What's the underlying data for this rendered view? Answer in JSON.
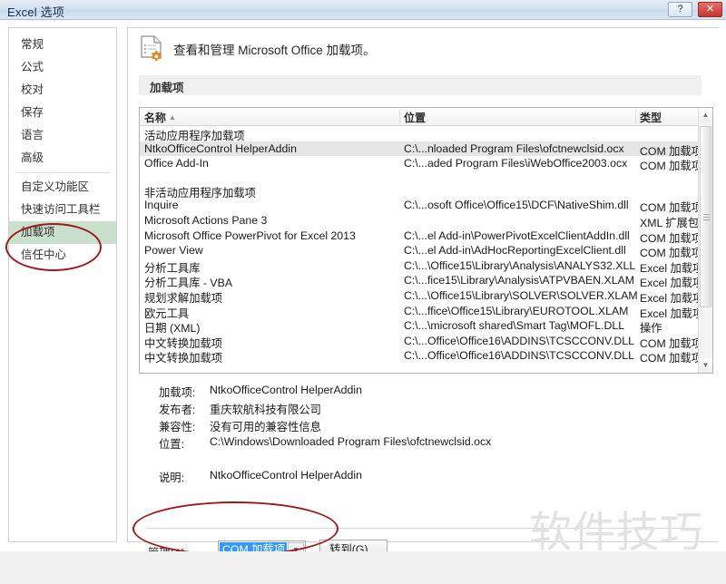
{
  "window": {
    "title": "Excel 选项",
    "help_button": "?",
    "close_button": "✕"
  },
  "sidebar": {
    "items": [
      {
        "label": "常规",
        "selected": false
      },
      {
        "label": "公式",
        "selected": false
      },
      {
        "label": "校对",
        "selected": false
      },
      {
        "label": "保存",
        "selected": false
      },
      {
        "label": "语言",
        "selected": false
      },
      {
        "label": "高级",
        "selected": false
      },
      {
        "label": "自定义功能区",
        "selected": false
      },
      {
        "label": "快速访问工具栏",
        "selected": false
      },
      {
        "label": "加载项",
        "selected": true
      },
      {
        "label": "信任中心",
        "selected": false
      }
    ],
    "separator_after_index": 5
  },
  "pane": {
    "header_title": "查看和管理 Microsoft Office 加载项。",
    "header_icon": "document-gear-icon",
    "section_label": "加载项"
  },
  "list": {
    "columns": [
      {
        "label": "名称",
        "sort_indicator": "▲"
      },
      {
        "label": "位置",
        "sort_indicator": ""
      },
      {
        "label": "类型",
        "sort_indicator": ""
      }
    ],
    "rows": [
      {
        "kind": "group",
        "name": "活动应用程序加载项",
        "location": "",
        "type": "",
        "selected": false
      },
      {
        "kind": "item",
        "name": "NtkoOfficeControl HelperAddin",
        "location": "C:\\...nloaded Program Files\\ofctnewclsid.ocx",
        "type": "COM 加载项",
        "selected": true
      },
      {
        "kind": "item",
        "name": "Office Add-In",
        "location": "C:\\...aded Program Files\\iWebOffice2003.ocx",
        "type": "COM 加载项",
        "selected": false
      },
      {
        "kind": "spacer",
        "name": "",
        "location": "",
        "type": "",
        "selected": false
      },
      {
        "kind": "group",
        "name": "非活动应用程序加载项",
        "location": "",
        "type": "",
        "selected": false
      },
      {
        "kind": "item",
        "name": "Inquire",
        "location": "C:\\...osoft Office\\Office15\\DCF\\NativeShim.dll",
        "type": "COM 加载项",
        "selected": false
      },
      {
        "kind": "item",
        "name": "Microsoft Actions Pane 3",
        "location": "",
        "type": "XML 扩展包",
        "selected": false
      },
      {
        "kind": "item",
        "name": "Microsoft Office PowerPivot for Excel 2013",
        "location": "C:\\...el Add-in\\PowerPivotExcelClientAddIn.dll",
        "type": "COM 加载项",
        "selected": false
      },
      {
        "kind": "item",
        "name": "Power View",
        "location": "C:\\...el Add-in\\AdHocReportingExcelClient.dll",
        "type": "COM 加载项",
        "selected": false
      },
      {
        "kind": "item",
        "name": "分析工具库",
        "location": "C:\\...\\Office15\\Library\\Analysis\\ANALYS32.XLL",
        "type": "Excel 加载项",
        "selected": false
      },
      {
        "kind": "item",
        "name": "分析工具库 - VBA",
        "location": "C:\\...fice15\\Library\\Analysis\\ATPVBAEN.XLAM",
        "type": "Excel 加载项",
        "selected": false
      },
      {
        "kind": "item",
        "name": "规划求解加载项",
        "location": "C:\\...\\Office15\\Library\\SOLVER\\SOLVER.XLAM",
        "type": "Excel 加载项",
        "selected": false
      },
      {
        "kind": "item",
        "name": "欧元工具",
        "location": "C:\\...ffice\\Office15\\Library\\EUROTOOL.XLAM",
        "type": "Excel 加载项",
        "selected": false
      },
      {
        "kind": "item",
        "name": "日期 (XML)",
        "location": "C:\\...\\microsoft shared\\Smart Tag\\MOFL.DLL",
        "type": "操作",
        "selected": false
      },
      {
        "kind": "item",
        "name": "中文转换加载项",
        "location": "C:\\...Office\\Office16\\ADDINS\\TCSCCONV.DLL",
        "type": "COM 加载项",
        "selected": false
      },
      {
        "kind": "item",
        "name": "中文转换加载项",
        "location": "C:\\...Office\\Office16\\ADDINS\\TCSCCONV.DLL",
        "type": "COM 加载项",
        "selected": false
      }
    ],
    "scrollbar": {
      "up_arrow": "▲",
      "down_arrow": "▼",
      "grip": "grip-icon"
    }
  },
  "details": [
    {
      "label": "加载项:",
      "value": "NtkoOfficeControl HelperAddin"
    },
    {
      "label": "发布者:",
      "value": "重庆软航科技有限公司"
    },
    {
      "label": "兼容性:",
      "value": "没有可用的兼容性信息"
    },
    {
      "label": "位置:",
      "value": "C:\\Windows\\Downloaded Program Files\\ofctnewclsid.ocx"
    }
  ],
  "description": {
    "label": "说明:",
    "value": "NtkoOfficeControl HelperAddin"
  },
  "footer": {
    "manage_label_pre": "管理(",
    "manage_label_key": "A",
    "manage_label_post": "):",
    "combo_value": "COM 加载项",
    "combo_arrow": "▼",
    "goto_pre": "转到(",
    "goto_key": "G",
    "goto_post": ")..."
  },
  "watermark": {
    "text": "软件技巧"
  },
  "annotations": [
    {
      "name": "nav-addins-highlight",
      "color": "#9e1b1b"
    },
    {
      "name": "manage-combo-highlight",
      "color": "#9e1b1b"
    }
  ]
}
